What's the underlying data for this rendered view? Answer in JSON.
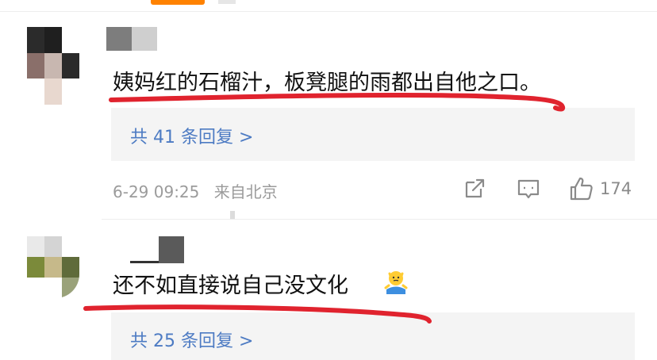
{
  "comments": [
    {
      "text": "姨妈红的石榴汁，板凳腿的雨都出自他之口。",
      "reply_link": "共 41 条回复 >",
      "date": "6-29 09:25",
      "location": "来自北京",
      "likes": "174",
      "actions": {
        "share_icon": "share-icon",
        "comment_icon": "comment-icon",
        "like_icon": "thumbs-up-icon"
      }
    },
    {
      "text": "还不如直接说自己没文化",
      "emoji": "shrugging-person-emoji",
      "reply_link": "共 25 条回复 >"
    }
  ],
  "colors": {
    "link": "#4d7bc3",
    "meta": "#9b9b9b",
    "highlight_underline": "#e0232e",
    "accent": "#ff8200"
  }
}
